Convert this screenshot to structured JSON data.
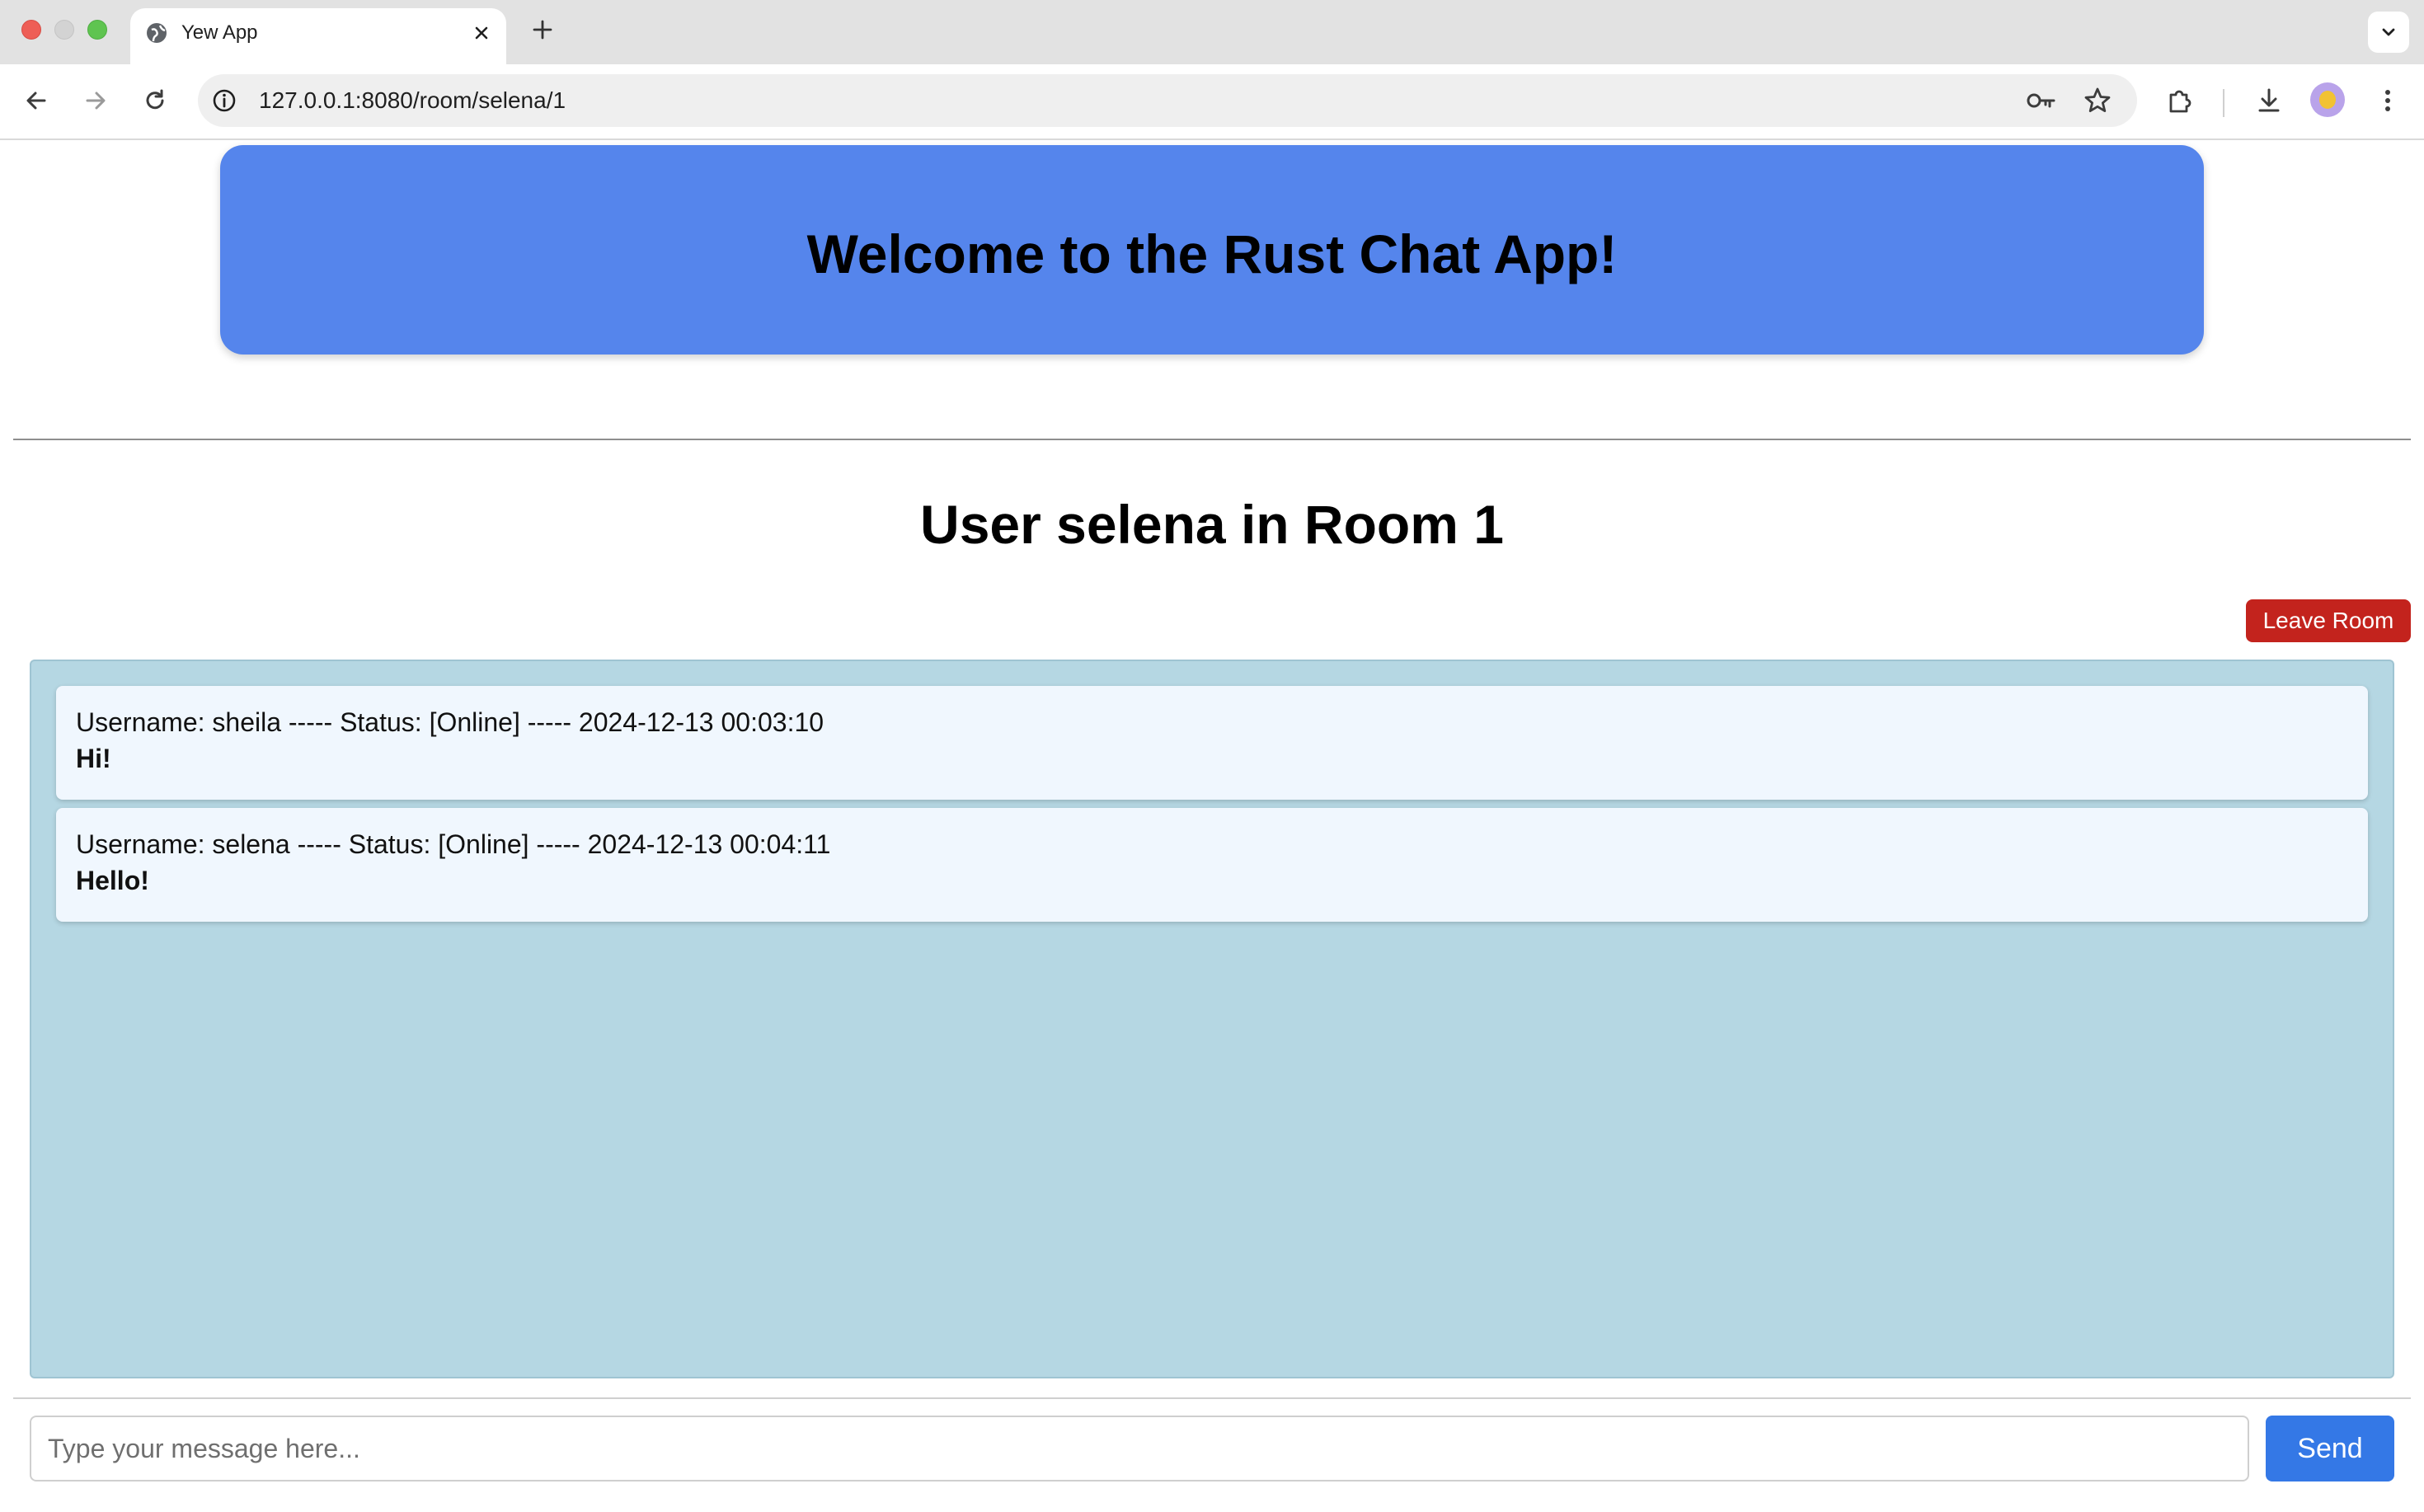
{
  "browser": {
    "tab_title": "Yew App",
    "url": "127.0.0.1:8080/room/selena/1"
  },
  "page": {
    "hero_title": "Welcome to the Rust Chat App!",
    "room_title": "User selena in Room 1",
    "leave_button": "Leave Room",
    "messages": [
      {
        "meta": "Username: sheila ----- Status: [Online] ----- 2024-12-13 00:03:10",
        "text": "Hi!"
      },
      {
        "meta": "Username: selena ----- Status: [Online] ----- 2024-12-13 00:04:11",
        "text": "Hello!"
      }
    ],
    "input_placeholder": "Type your message here...",
    "input_value": "",
    "send_button": "Send"
  },
  "colors": {
    "hero_bg": "#5585ec",
    "chat_bg": "#b5d7e3",
    "message_bg": "#f0f7fe",
    "leave_button": "#c3231d",
    "send_button": "#3478e6"
  },
  "icons": [
    "globe-icon",
    "close-icon",
    "plus-icon",
    "chevron-down-icon",
    "back-arrow-icon",
    "forward-arrow-icon",
    "reload-icon",
    "info-icon",
    "key-icon",
    "star-icon",
    "extensions-icon",
    "download-icon",
    "avatar-icon",
    "more-vert-icon"
  ]
}
